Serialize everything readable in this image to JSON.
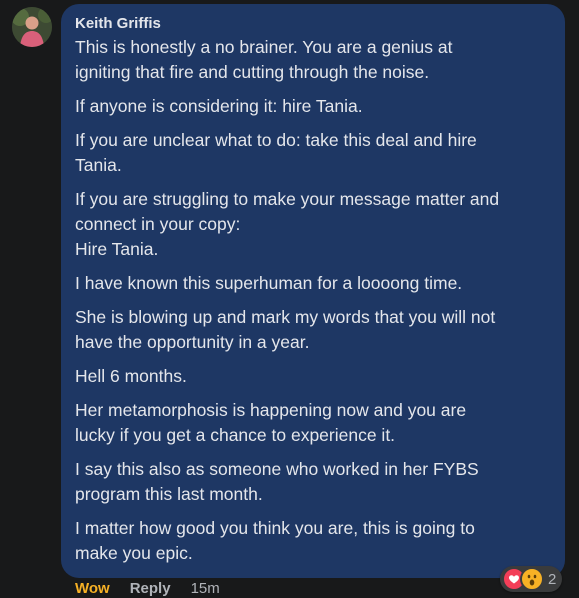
{
  "comment": {
    "author": "Keith Griffis",
    "paragraphs": [
      "This is honestly a no brainer. You are a genius at\nigniting that fire and cutting through the noise.",
      "If anyone is considering it: hire Tania.",
      "If you are unclear what to do: take this deal and hire\nTania.",
      "If you are struggling to make your message matter and\nconnect in your copy:\nHire Tania.",
      "I have known this superhuman for a loooong time.",
      "She is blowing up and mark my words that you will not\nhave the opportunity in a year.",
      "Hell 6 months.",
      "Her metamorphosis is happening now and you are\nlucky if you get a chance to experience it.",
      "I say this also as someone who worked in her FYBS\nprogram this last month.",
      "I matter how good you think you are, this is going to\nmake you epic."
    ],
    "actions": {
      "reaction_label": "Wow",
      "reply_label": "Reply",
      "timestamp": "15m"
    },
    "reactions": {
      "icons": [
        "love-icon",
        "wow-icon"
      ],
      "count": "2"
    }
  },
  "colors": {
    "background": "#18191a",
    "bubble": "#1e3764",
    "text": "#e4e6eb",
    "muted": "#b0b3b8",
    "wow": "#f7b125",
    "love": "#f33e58"
  }
}
